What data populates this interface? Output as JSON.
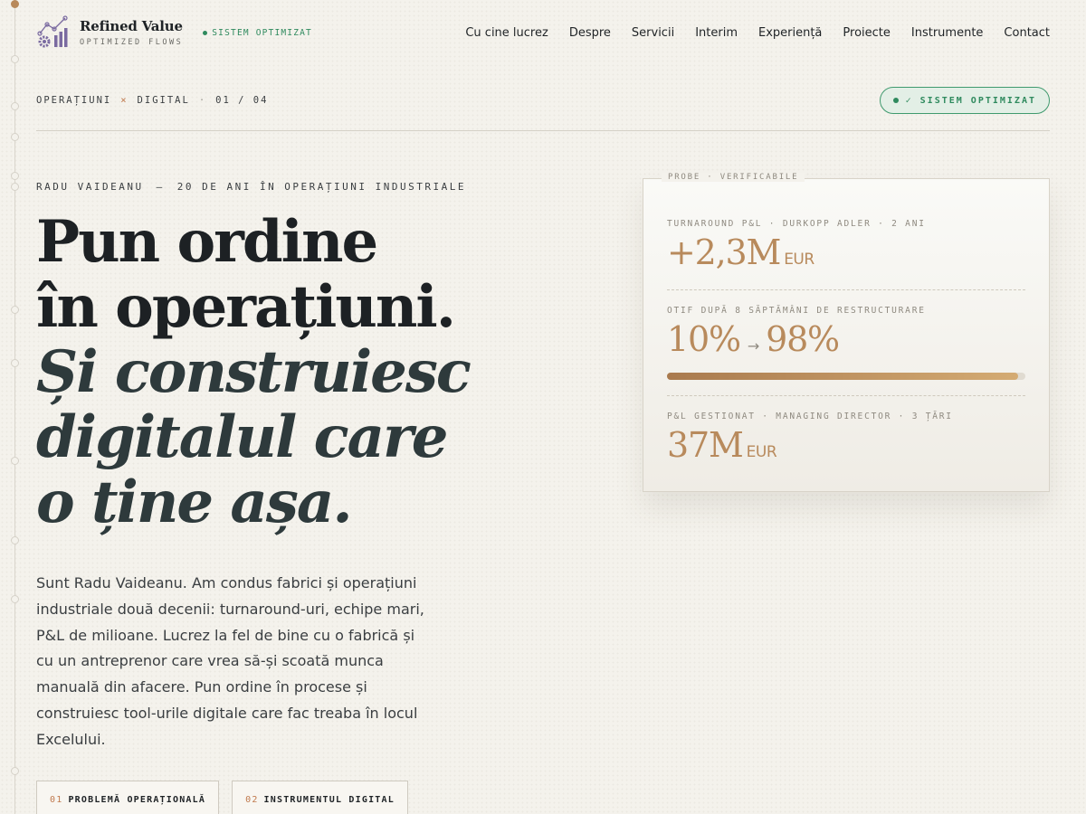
{
  "brand": {
    "name": "Refined Value",
    "tagline": "OPTIMIZED FLOWS",
    "status": "SISTEM OPTIMIZAT"
  },
  "nav": [
    {
      "label": "Cu cine lucrez"
    },
    {
      "label": "Despre"
    },
    {
      "label": "Servicii"
    },
    {
      "label": "Interim"
    },
    {
      "label": "Experiență"
    },
    {
      "label": "Proiecte"
    },
    {
      "label": "Instrumente"
    },
    {
      "label": "Contact"
    }
  ],
  "section": {
    "left": "OPERAȚIUNI",
    "mark": "×",
    "right": "DIGITAL",
    "sep": "·",
    "counter": "01 / 04",
    "badge": "✓  SISTEM OPTIMIZAT"
  },
  "hero": {
    "eyebrow_name": "RADU VAIDEANU",
    "eyebrow_dash": "—",
    "eyebrow_role": "20 DE ANI ÎN OPERAȚIUNI INDUSTRIALE",
    "line1": "Pun ordine",
    "line2": "în operațiuni.",
    "line3": "Și construiesc",
    "line4": "digitalul care",
    "line5": "o ține așa.",
    "lede": "Sunt Radu Vaideanu. Am condus fabrici și operațiuni industriale două decenii: turnaround-uri, echipe mari, P&L de milioane. Lucrez la fel de bine cu o fabrică și cu un antreprenor care vrea să-și scoată munca manuală din afacere. Pun ordine în procese și construiesc tool-urile digitale care fac treaba în locul Excelului.",
    "ctas": [
      {
        "num": "01",
        "label": "PROBLEMĂ OPERAȚIONALĂ"
      },
      {
        "num": "02",
        "label": "INSTRUMENTUL DIGITAL"
      }
    ]
  },
  "evidence": {
    "label": "PROBE · VERIFICABILE",
    "metrics": [
      {
        "caption": "TURNAROUND P&L · DURKOPP ADLER · 2 ANI",
        "value": "+2,3M",
        "unit": "EUR"
      },
      {
        "caption": "OTIF DUPĂ 8 SĂPTĂMÂNI DE RESTRUCTURARE",
        "from": "10%",
        "arrow": "→",
        "to": "98%",
        "progress": 0.98
      },
      {
        "caption": "P&L GESTIONAT · MANAGING DIRECTOR · 3 ȚĂRI",
        "value": "37M",
        "unit": "EUR"
      }
    ]
  },
  "colors": {
    "accent": "#b88a5c",
    "status": "#2f8a5e",
    "background": "#f4f2ec"
  }
}
